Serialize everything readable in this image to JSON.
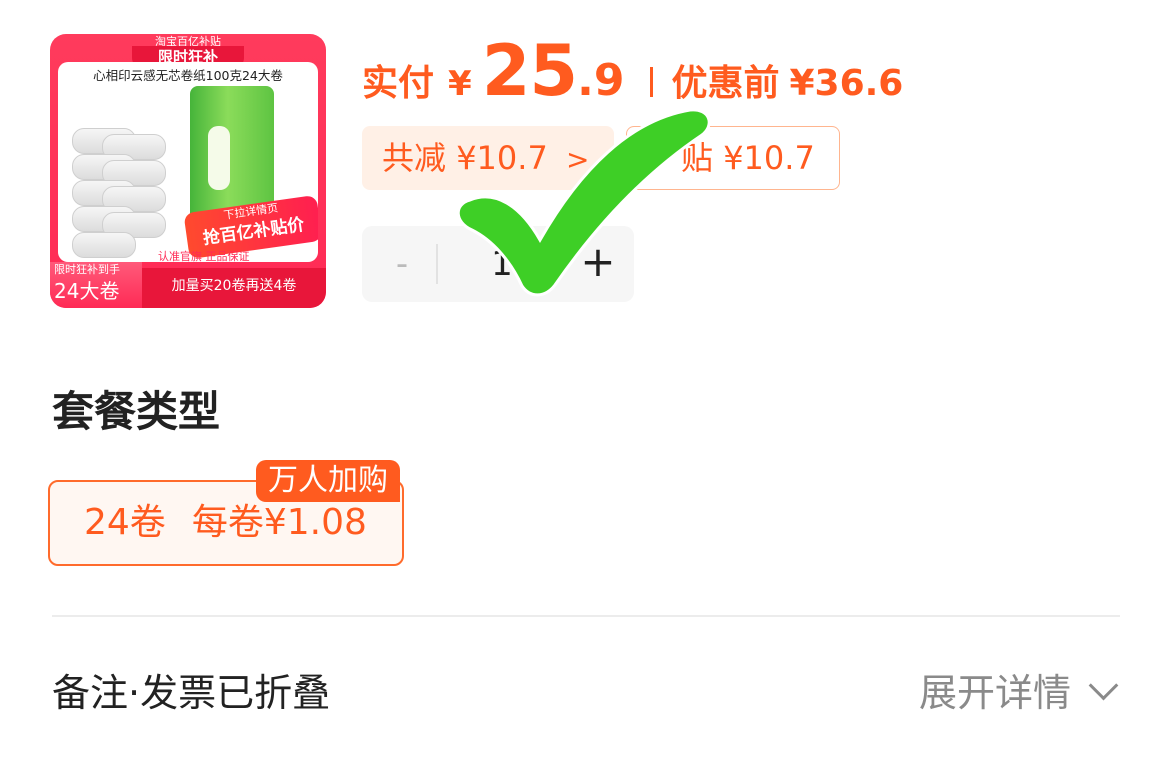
{
  "product": {
    "image_brand_text": "淘宝百亿补贴",
    "image_badge": "限时狂补",
    "image_title": "心相印云感无芯卷纸100克24大卷",
    "image_sticker_top": "下拉详情页",
    "image_sticker_main": "抢百亿补贴价",
    "image_guarantee": "认准官旗 正品保证",
    "image_corner_small": "限时狂补到手",
    "image_corner_big": "24大卷",
    "image_bottom_promo": "加量买20卷再送4卷"
  },
  "price": {
    "pay_label": "实付",
    "currency": "¥",
    "integer": "25",
    "decimal": ".9",
    "original_label": "优惠前",
    "original_value": "¥36.6",
    "accent_color": "#ff5b1f"
  },
  "discounts": {
    "total_label": "共减",
    "total_value": "¥10.7",
    "total_chevron": ">",
    "subsidy_text": "贴",
    "subsidy_value": "¥10.7"
  },
  "quantity": {
    "minus": "-",
    "value": "1",
    "plus": "+"
  },
  "overlay": {
    "icon": "checkmark-icon",
    "color": "#3ecf26"
  },
  "package": {
    "section_title": "套餐类型",
    "options": [
      {
        "count": "24卷",
        "unit_price": "每卷¥1.08",
        "badge": "万人加购",
        "selected": true
      }
    ]
  },
  "remarks": {
    "label": "备注·发票已折叠",
    "expand_label": "展开详情",
    "expand_icon": "chevron-down-icon"
  }
}
